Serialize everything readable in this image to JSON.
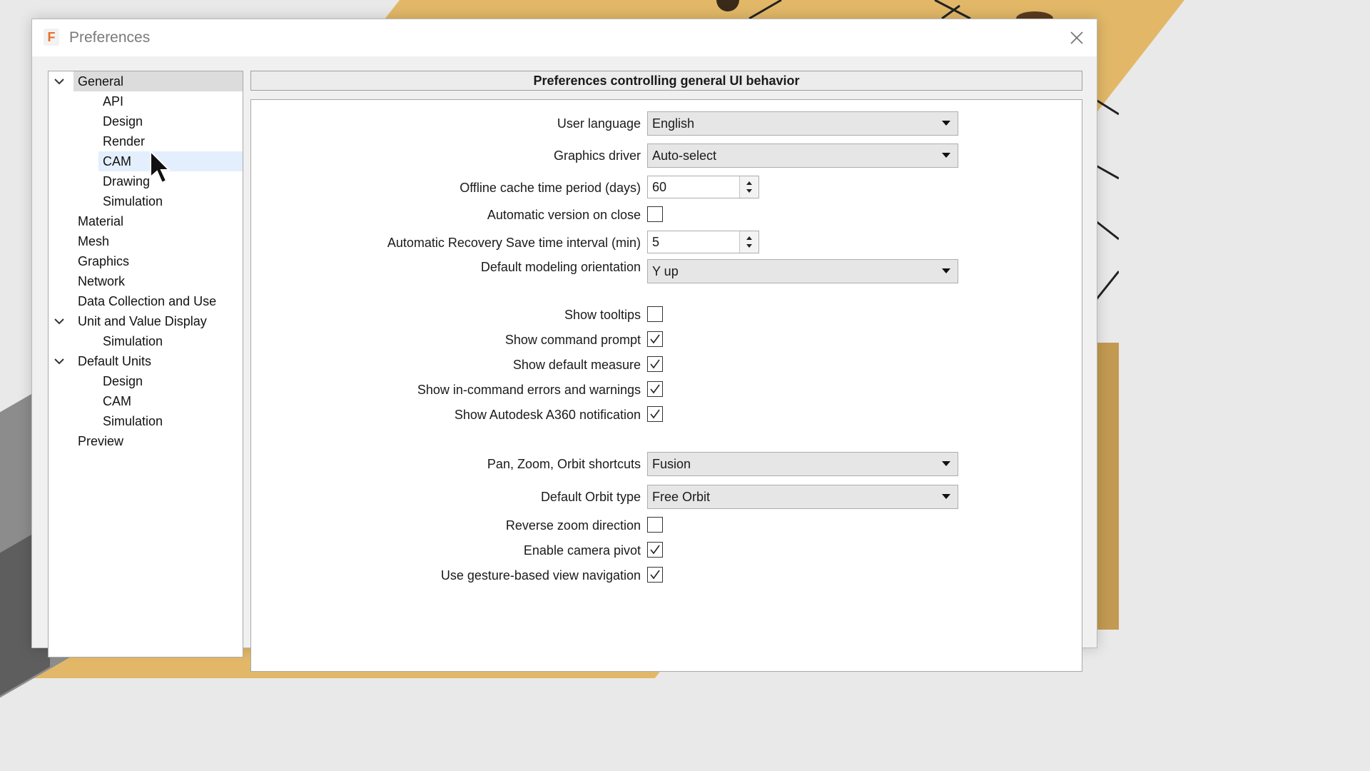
{
  "window": {
    "title": "Preferences",
    "app_icon_letter": "F",
    "close_icon": "close-icon"
  },
  "tree": {
    "items": [
      {
        "label": "General",
        "level": 0,
        "expanded": true,
        "selected": true
      },
      {
        "label": "API",
        "level": 1
      },
      {
        "label": "Design",
        "level": 1
      },
      {
        "label": "Render",
        "level": 1
      },
      {
        "label": "CAM",
        "level": 1,
        "hovered": true
      },
      {
        "label": "Drawing",
        "level": 1
      },
      {
        "label": "Simulation",
        "level": 1
      },
      {
        "label": "Material",
        "level": 0
      },
      {
        "label": "Mesh",
        "level": 0
      },
      {
        "label": "Graphics",
        "level": 0
      },
      {
        "label": "Network",
        "level": 0
      },
      {
        "label": "Data Collection and Use",
        "level": 0
      },
      {
        "label": "Unit and Value Display",
        "level": 0,
        "expanded": true
      },
      {
        "label": "Simulation",
        "level": 1
      },
      {
        "label": "Default Units",
        "level": 0,
        "expanded": true
      },
      {
        "label": "Design",
        "level": 1
      },
      {
        "label": "CAM",
        "level": 1
      },
      {
        "label": "Simulation",
        "level": 1
      },
      {
        "label": "Preview",
        "level": 0
      }
    ]
  },
  "panel": {
    "header": "Preferences controlling general UI behavior",
    "user_language": {
      "label": "User language",
      "value": "English"
    },
    "graphics_driver": {
      "label": "Graphics driver",
      "value": "Auto-select"
    },
    "offline_cache": {
      "label": "Offline cache time period (days)",
      "value": "60"
    },
    "auto_version": {
      "label": "Automatic version on close",
      "checked": false
    },
    "auto_recovery": {
      "label": "Automatic Recovery Save time interval (min)",
      "value": "5"
    },
    "modeling_orientation": {
      "label": "Default modeling orientation",
      "value": "Y up"
    },
    "show_tooltips": {
      "label": "Show tooltips",
      "checked": false
    },
    "show_command_prompt": {
      "label": "Show command prompt",
      "checked": true
    },
    "show_default_measure": {
      "label": "Show default measure",
      "checked": true
    },
    "show_errors": {
      "label": "Show in-command errors and warnings",
      "checked": true
    },
    "show_a360": {
      "label": "Show Autodesk A360 notification",
      "checked": true
    },
    "pan_zoom_orbit": {
      "label": "Pan, Zoom, Orbit shortcuts",
      "value": "Fusion"
    },
    "default_orbit": {
      "label": "Default Orbit type",
      "value": "Free Orbit"
    },
    "reverse_zoom": {
      "label": "Reverse zoom direction",
      "checked": false
    },
    "camera_pivot": {
      "label": "Enable camera pivot",
      "checked": true
    },
    "gesture_nav": {
      "label": "Use gesture-based view navigation",
      "checked": true
    }
  },
  "colors": {
    "selection": "#dcdcdc",
    "hover": "#e3effc",
    "app_icon": "#e8702a",
    "workspace_wood": "#e2b868"
  }
}
